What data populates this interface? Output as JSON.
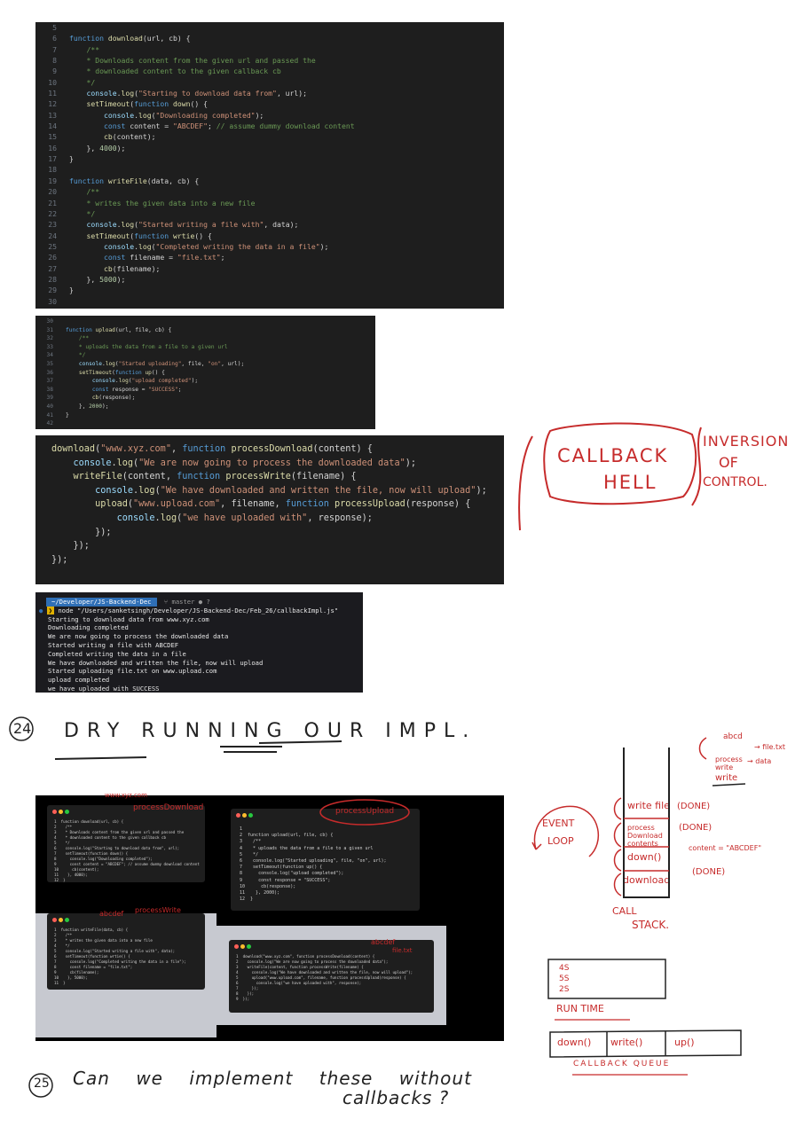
{
  "code1": {
    "lines": [
      {
        "n": "5",
        "html": ""
      },
      {
        "n": "6",
        "html": "<span class='kw'>function</span> <span class='fn'>download</span>(url, cb) {"
      },
      {
        "n": "7",
        "html": "    <span class='cm'>/**</span>"
      },
      {
        "n": "8",
        "html": "    <span class='cm'>* Downloads content from the given url and passed the</span>"
      },
      {
        "n": "9",
        "html": "    <span class='cm'>* downloaded content to the given callback cb</span>"
      },
      {
        "n": "10",
        "html": "    <span class='cm'>*/</span>"
      },
      {
        "n": "11",
        "html": "    <span class='var'>console</span>.<span class='fn'>log</span>(<span class='str'>\"Starting to download data from\"</span>, url);"
      },
      {
        "n": "12",
        "html": "    <span class='fn'>setTimeout</span>(<span class='kw'>function</span> <span class='fn'>down</span>() {"
      },
      {
        "n": "13",
        "html": "        <span class='var'>console</span>.<span class='fn'>log</span>(<span class='str'>\"Downloading completed\"</span>);"
      },
      {
        "n": "14",
        "html": "        <span class='kw'>const</span> content = <span class='str'>\"ABCDEF\"</span>; <span class='cm'>// assume dummy download content</span>"
      },
      {
        "n": "15",
        "html": "        <span class='fn'>cb</span>(content);"
      },
      {
        "n": "16",
        "html": "    }, <span class='num'>4000</span>);"
      },
      {
        "n": "17",
        "html": "}"
      },
      {
        "n": "18",
        "html": ""
      },
      {
        "n": "19",
        "html": "<span class='kw'>function</span> <span class='fn'>writeFile</span>(data, cb) {"
      },
      {
        "n": "20",
        "html": "    <span class='cm'>/**</span>"
      },
      {
        "n": "21",
        "html": "    <span class='cm'>* writes the given data into a new file</span>"
      },
      {
        "n": "22",
        "html": "    <span class='cm'>*/</span>"
      },
      {
        "n": "23",
        "html": "    <span class='var'>console</span>.<span class='fn'>log</span>(<span class='str'>\"Started writing a file with\"</span>, data);"
      },
      {
        "n": "24",
        "html": "    <span class='fn'>setTimeout</span>(<span class='kw'>function</span> <span class='fn'>wrtie</span>() {"
      },
      {
        "n": "25",
        "html": "        <span class='var'>console</span>.<span class='fn'>log</span>(<span class='str'>\"Completed writing the data in a file\"</span>);"
      },
      {
        "n": "26",
        "html": "        <span class='kw'>const</span> filename = <span class='str'>\"file.txt\"</span>;"
      },
      {
        "n": "27",
        "html": "        <span class='fn'>cb</span>(filename);"
      },
      {
        "n": "28",
        "html": "    }, <span class='num'>5000</span>);"
      },
      {
        "n": "29",
        "html": "}"
      },
      {
        "n": "30",
        "html": ""
      }
    ]
  },
  "code2": {
    "lines": [
      {
        "n": "30",
        "html": ""
      },
      {
        "n": "31",
        "html": "<span class='kw'>function</span> <span class='fn'>upload</span>(url, file, cb) {"
      },
      {
        "n": "32",
        "html": "    <span class='cm'>/**</span>"
      },
      {
        "n": "33",
        "html": "    <span class='cm'>* uploads the data from a file to a given url</span>"
      },
      {
        "n": "34",
        "html": "    <span class='cm'>*/</span>"
      },
      {
        "n": "35",
        "html": "    <span class='var'>console</span>.<span class='fn'>log</span>(<span class='str'>\"Started uploading\"</span>, file, <span class='str'>\"on\"</span>, url);"
      },
      {
        "n": "36",
        "html": "    <span class='fn'>setTimeout</span>(<span class='kw'>function</span> <span class='fn'>up</span>() {"
      },
      {
        "n": "37",
        "html": "        <span class='var'>console</span>.<span class='fn'>log</span>(<span class='str'>\"upload completed\"</span>);"
      },
      {
        "n": "38",
        "html": "        <span class='kw'>const</span> response = <span class='str'>\"SUCCESS\"</span>;"
      },
      {
        "n": "39",
        "html": "        <span class='fn'>cb</span>(response);"
      },
      {
        "n": "40",
        "html": "    }, <span class='num'>2000</span>);"
      },
      {
        "n": "41",
        "html": "}"
      },
      {
        "n": "42",
        "html": ""
      }
    ]
  },
  "code3": {
    "lines": [
      {
        "html": "<span class='fn'>download</span>(<span class='str'>\"www.xyz.com\"</span>, <span class='kw'>function</span> <span class='fn'>processDownload</span>(content) {"
      },
      {
        "html": "    <span class='var'>console</span>.<span class='fn'>log</span>(<span class='str'>\"We are now going to process the downloaded data\"</span>);"
      },
      {
        "html": "    <span class='fn'>writeFile</span>(content, <span class='kw'>function</span> <span class='fn'>processWrite</span>(filename) {"
      },
      {
        "html": "        <span class='var'>console</span>.<span class='fn'>log</span>(<span class='str'>\"We have downloaded and written the file, now will upload\"</span>);"
      },
      {
        "html": "        <span class='fn'>upload</span>(<span class='str'>\"www.upload.com\"</span>, filename, <span class='kw'>function</span> <span class='fn'>processUpload</span>(response) {"
      },
      {
        "html": "            <span class='var'>console</span>.<span class='fn'>log</span>(<span class='str'>\"we have uploaded with\"</span>, response);"
      },
      {
        "html": "        });"
      },
      {
        "html": "    });"
      },
      {
        "html": "});"
      }
    ]
  },
  "terminal": {
    "path": "~/Developer/JS-Backend-Dec",
    "branch": "master",
    "branch_mark": "⑂",
    "status": "● ?",
    "command": "node \"/Users/sanketsingh/Developer/JS-Backend-Dec/Feb_26/callbackImpl.js\"",
    "output": [
      "Starting to download data from www.xyz.com",
      "Downloading completed",
      "We are now going to process the downloaded data",
      "Started writing a file with ABCDEF",
      "Completed writing the data in a file",
      "We have downloaded and written the file, now will upload",
      "Started uploading file.txt on www.upload.com",
      "upload completed",
      "we have uploaded with SUCCESS"
    ]
  },
  "notes": {
    "callback_hell": [
      "CALLBACK",
      "HELL"
    ],
    "inversion": [
      "INVERSION",
      "OF",
      "CONTROL."
    ],
    "section24_num": "24",
    "section24_title": "DRY RUNNING OUR IMPL.",
    "section25_num": "25",
    "section25_line1": "Can    we    implement    these    without",
    "section25_line2": "callbacks ?"
  },
  "stack": {
    "frames": [
      "download",
      "down()",
      "process Download contents",
      "write file"
    ],
    "status": [
      "(DONE)",
      "(DONE)",
      "(DONE)"
    ],
    "content_note": "content = \"ABCDEF\"",
    "top_notes": [
      "abcd",
      "process write",
      "write",
      "→ file.txt",
      "→ data"
    ],
    "event_loop": [
      "EVENT",
      "LOOP"
    ],
    "call_stack_label": [
      "CALL",
      "STACK."
    ],
    "runtime_items": [
      "4S",
      "5S",
      "2S"
    ],
    "runtime_label": "RUN TIME",
    "queue_items": [
      "down()",
      "write()",
      "up()"
    ],
    "queue_label": "CALLBACK QUEUE"
  },
  "thumbs": {
    "t1_note": "processDownload",
    "t1_note2": "www.xyz.com",
    "t2_note": "processUpload",
    "t3_note": "processWrite",
    "t3_note2": "abcdef",
    "t4_note": "abcdef",
    "t4_note2": "file.txt",
    "t1_lines": [
      "function download(url, cb) {",
      "  /**",
      "  * Downloads content from the given url and passed the",
      "  * downloaded content to the given callback cb",
      "  */",
      "  console.log(\"Starting to download data from\", url);",
      "  setTimeout(function down() {",
      "    console.log(\"Downloading completed\");",
      "    const content = \"ABCDEF\"; // assume dummy download content",
      "    cb(content);",
      "  }, 4000);",
      "}"
    ],
    "t2_lines": [
      "",
      "function upload(url, file, cb) {",
      "  /**",
      "  * uploads the data from a file to a given url",
      "  */",
      "  console.log(\"Started uploading\", file, \"on\", url);",
      "  setTimeout(function up() {",
      "    console.log(\"upload completed\");",
      "    const response = \"SUCCESS\";",
      "    cb(response);",
      "  }, 2000);",
      "}"
    ],
    "t3_lines": [
      "function writeFile(data, cb) {",
      "  /**",
      "  * writes the given data into a new file",
      "  */",
      "  console.log(\"Started writing a file with\", data);",
      "  setTimeout(function wrtie() {",
      "    console.log(\"Completed writing the data in a file\");",
      "    const filename = \"file.txt\";",
      "    cb(filename);",
      "  }, 5000);",
      "}"
    ],
    "t4_lines": [
      "download(\"www.xyz.com\", function processDownload(content) {",
      "  console.log(\"We are now going to process the downloaded data\");",
      "  writeFile(content, function processWrite(filename) {",
      "    console.log(\"We have downloaded and written the file, now will upload\");",
      "    upload(\"www.upload.com\", filename, function processUpload(response) {",
      "      console.log(\"we have uploaded with\", response);",
      "    });",
      "  });",
      "});"
    ]
  },
  "colors": {
    "ink": "#c62b2b",
    "editor_bg": "#1e1e1e"
  }
}
